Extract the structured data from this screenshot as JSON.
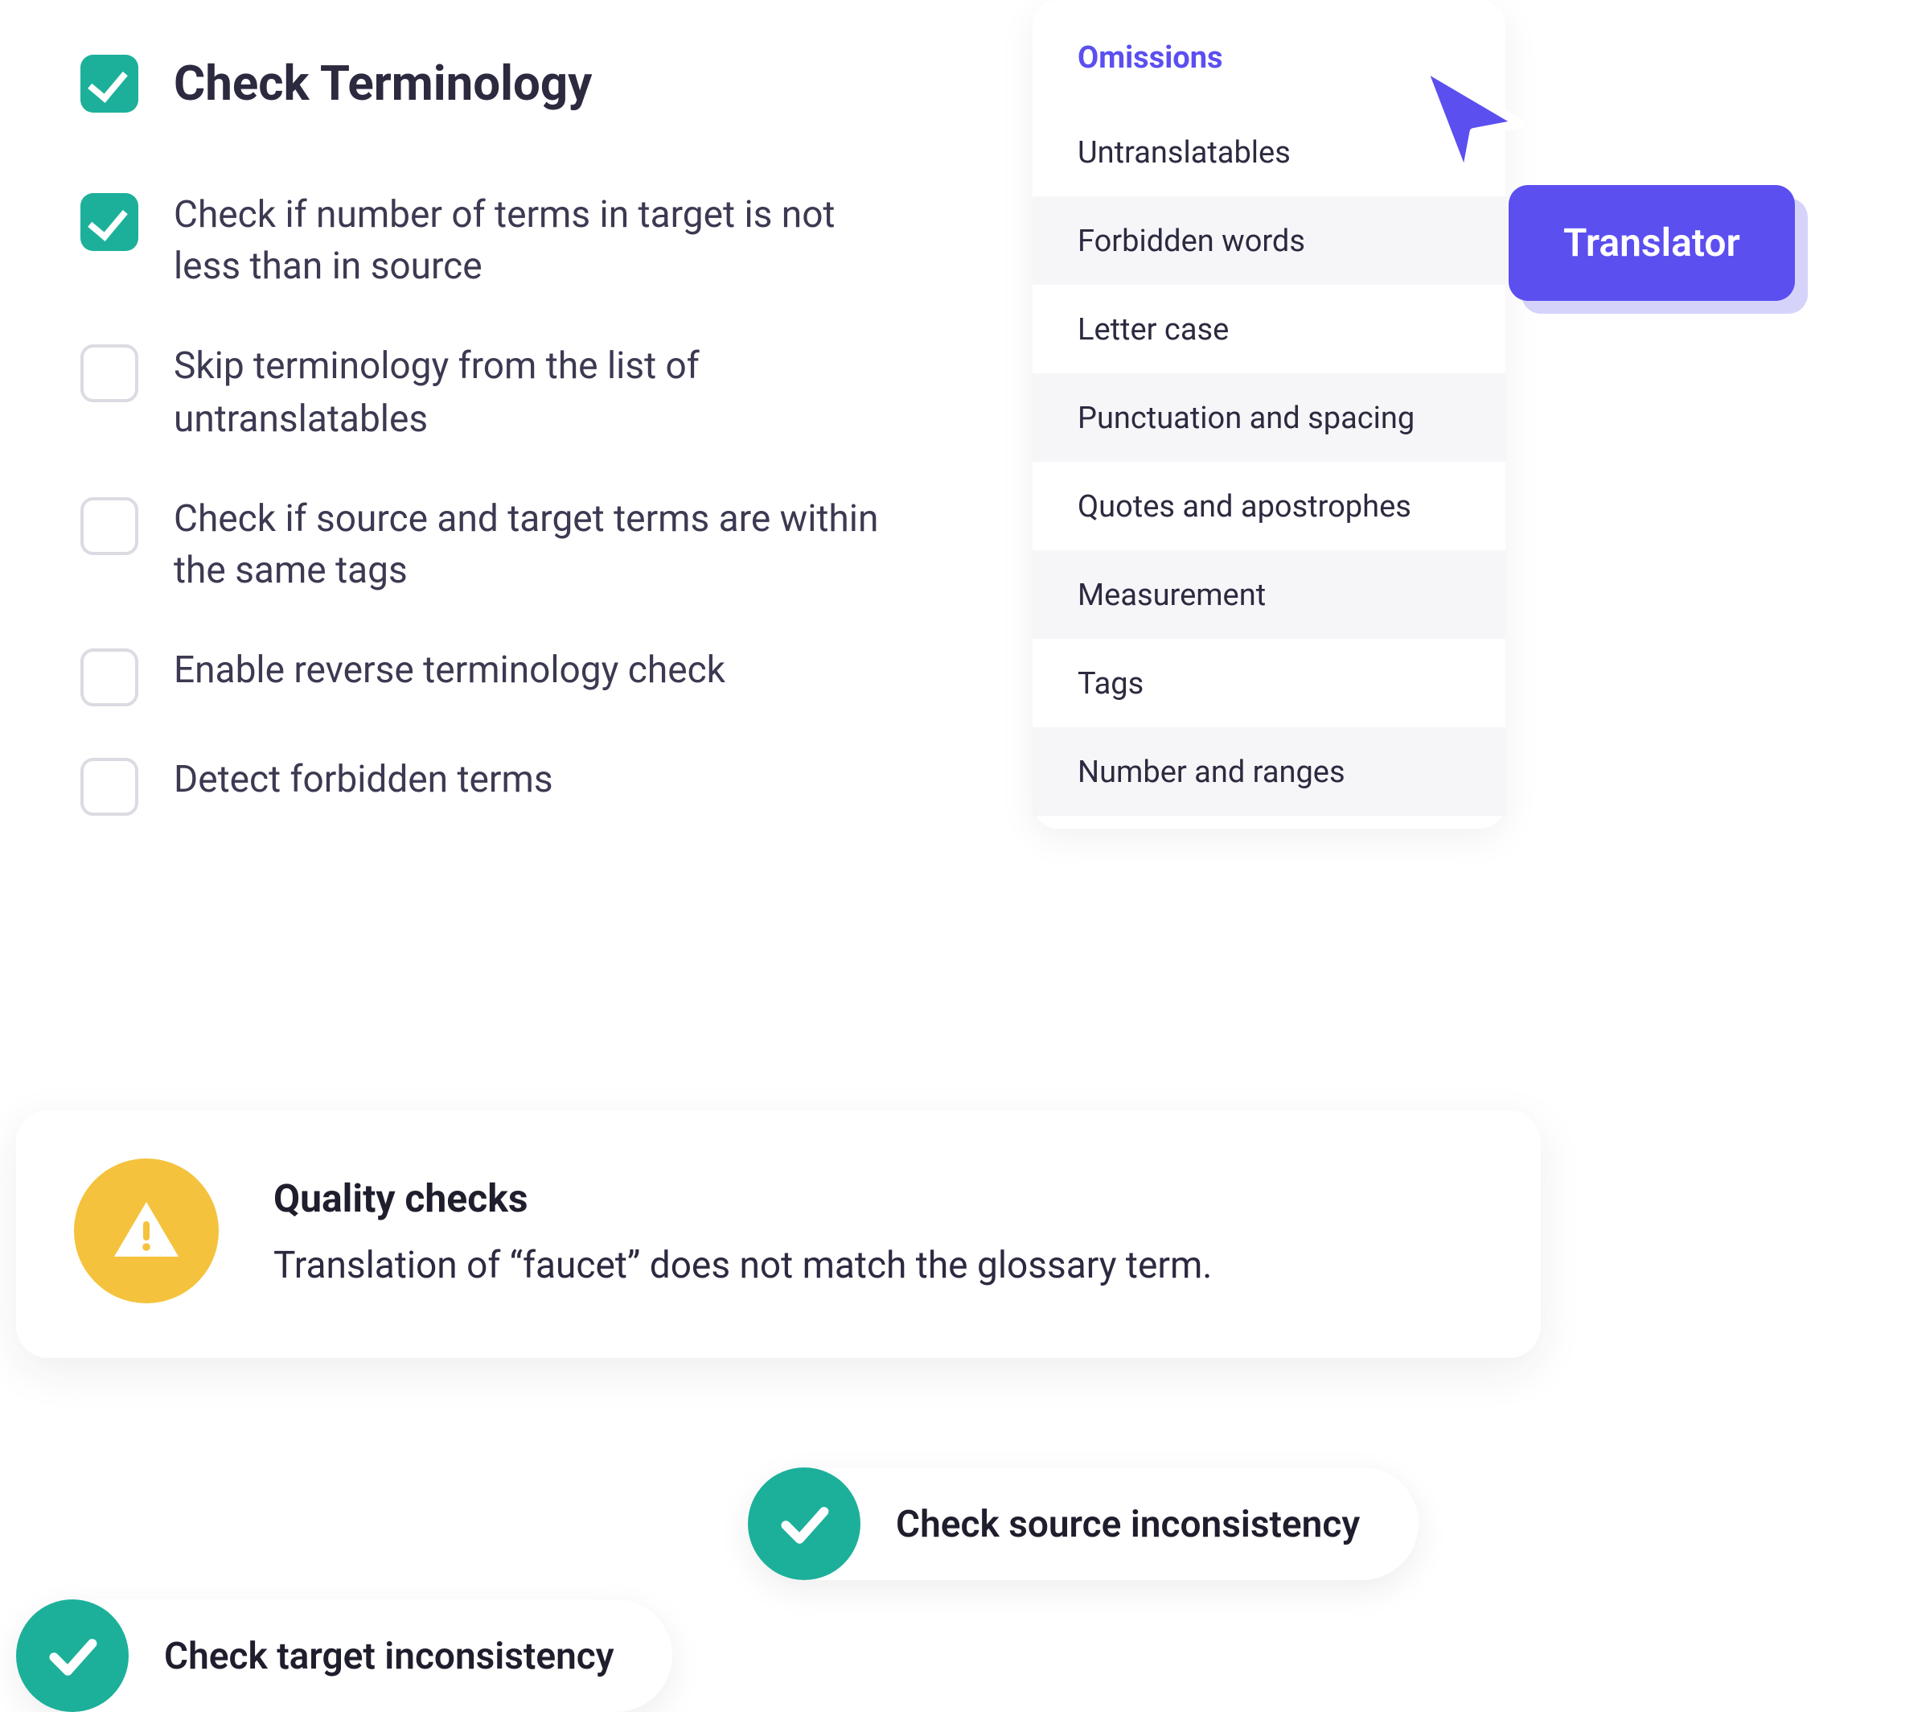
{
  "terminology": {
    "title": "Check Terminology",
    "items": [
      {
        "label": "Check if number of terms in target is not less than in source",
        "checked": true
      },
      {
        "label": "Skip terminology from the list of untranslatables",
        "checked": false
      },
      {
        "label": "Check if source and target terms are within the same tags",
        "checked": false
      },
      {
        "label": "Enable reverse terminology check",
        "checked": false
      },
      {
        "label": "Detect forbidden terms",
        "checked": false
      }
    ]
  },
  "categories": {
    "active": "Omissions",
    "items": [
      "Omissions",
      "Untranslatables",
      "Forbidden words",
      "Letter case",
      "Punctuation and spacing",
      "Quotes and apostrophes",
      "Measurement",
      "Tags",
      "Number and ranges"
    ]
  },
  "badge": {
    "label": "Translator"
  },
  "qualityChecks": {
    "title": "Quality checks",
    "message": "Translation of “faucet” does not match the glossary term."
  },
  "pills": {
    "source": "Check source inconsistency",
    "target": "Check target inconsistency"
  }
}
